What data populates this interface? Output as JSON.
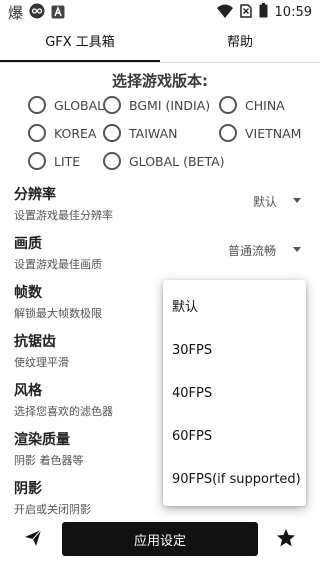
{
  "status_bar": {
    "app_glyph": "爆",
    "time": "10:59"
  },
  "tabs": [
    {
      "label": "GFX 工具箱",
      "selected": true
    },
    {
      "label": "帮助",
      "selected": false
    }
  ],
  "version": {
    "title": "选择游戏版本:",
    "options": [
      "GLOBAL",
      "BGMI (INDIA)",
      "CHINA",
      "KOREA",
      "TAIWAN",
      "VIETNAM",
      "LITE",
      "GLOBAL (BETA)"
    ]
  },
  "settings": [
    {
      "title": "分辨率",
      "desc": "设置游戏最佳分辨率",
      "value": "默认"
    },
    {
      "title": "画质",
      "desc": "设置游戏最佳画质",
      "value": "普通流畅"
    },
    {
      "title": "帧数",
      "desc": "解锁最大帧数极限"
    },
    {
      "title": "抗锯齿",
      "desc": "使纹理平滑"
    },
    {
      "title": "风格",
      "desc": "选择您喜欢的滤色器"
    },
    {
      "title": "渲染质量",
      "desc": "阴影 着色器等"
    },
    {
      "title": "阴影",
      "desc": "开启或关闭阴影"
    }
  ],
  "fps_dropdown": {
    "options": [
      "默认",
      "30FPS",
      "40FPS",
      "60FPS",
      "90FPS(if supported)"
    ]
  },
  "bottom": {
    "apply_label": "应用设定"
  },
  "icons": {
    "send": "send-icon",
    "star": "star-icon"
  }
}
